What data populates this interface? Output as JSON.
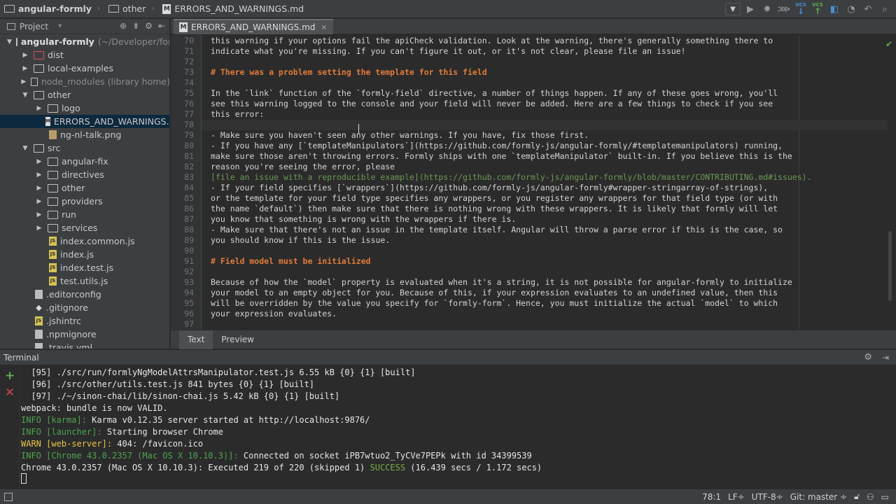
{
  "navbar": {
    "crumbs": [
      "angular-formly",
      "other",
      "ERRORS_AND_WARNINGS.md"
    ]
  },
  "project": {
    "title": "Project",
    "tree": [
      {
        "label": "angular-formly",
        "suffix": "(~/Developer/form",
        "depth": 0,
        "type": "folder",
        "open": true,
        "bold": true
      },
      {
        "label": "dist",
        "depth": 1,
        "type": "folder-red",
        "open": false
      },
      {
        "label": "local-examples",
        "depth": 1,
        "type": "folder",
        "open": false
      },
      {
        "label": "node_modules (library home)",
        "depth": 1,
        "type": "folder",
        "open": false,
        "muted": true
      },
      {
        "label": "other",
        "depth": 1,
        "type": "folder",
        "open": true
      },
      {
        "label": "logo",
        "depth": 2,
        "type": "folder",
        "open": false
      },
      {
        "label": "ERRORS_AND_WARNINGS.md",
        "depth": 2,
        "type": "md",
        "selected": true
      },
      {
        "label": "ng-nl-talk.png",
        "depth": 2,
        "type": "png"
      },
      {
        "label": "src",
        "depth": 1,
        "type": "folder",
        "open": true
      },
      {
        "label": "angular-fix",
        "depth": 2,
        "type": "folder",
        "open": false
      },
      {
        "label": "directives",
        "depth": 2,
        "type": "folder",
        "open": false
      },
      {
        "label": "other",
        "depth": 2,
        "type": "folder",
        "open": false
      },
      {
        "label": "providers",
        "depth": 2,
        "type": "folder",
        "open": false
      },
      {
        "label": "run",
        "depth": 2,
        "type": "folder",
        "open": false
      },
      {
        "label": "services",
        "depth": 2,
        "type": "folder",
        "open": false
      },
      {
        "label": "index.common.js",
        "depth": 2,
        "type": "js"
      },
      {
        "label": "index.js",
        "depth": 2,
        "type": "js"
      },
      {
        "label": "index.test.js",
        "depth": 2,
        "type": "js"
      },
      {
        "label": "test.utils.js",
        "depth": 2,
        "type": "js"
      },
      {
        "label": ".editorconfig",
        "depth": 1,
        "type": "file"
      },
      {
        "label": ".gitignore",
        "depth": 1,
        "type": "git"
      },
      {
        "label": ".jshintrc",
        "depth": 1,
        "type": "js"
      },
      {
        "label": ".npmignore",
        "depth": 1,
        "type": "file"
      },
      {
        "label": ".travis.yml",
        "depth": 1,
        "type": "file"
      }
    ]
  },
  "editor": {
    "tab_label": "ERRORS_AND_WARNINGS.md",
    "lines": [
      {
        "n": "70",
        "text": "this warning if your options fail the apiCheck validation. Look at the warning, there's generally something there to",
        "kind": "text"
      },
      {
        "n": "71",
        "text": "indicate what you're missing. If you can't figure it out, or it's not clear, please file an issue!",
        "kind": "text"
      },
      {
        "n": "72",
        "text": "",
        "kind": "text"
      },
      {
        "n": "73",
        "text": "# There was a problem setting the template for this field",
        "kind": "heading"
      },
      {
        "n": "74",
        "text": "",
        "kind": "text"
      },
      {
        "n": "75",
        "text": "In the `link` function of the `formly-field` directive, a number of things happen. If any of these goes wrong, you'll",
        "kind": "text"
      },
      {
        "n": "76",
        "text": "see this warning logged to the console and your field will never be added. Here are a few things to check if you see",
        "kind": "text"
      },
      {
        "n": "77",
        "text": "this error:",
        "kind": "text"
      },
      {
        "n": "78",
        "text": "",
        "kind": "current"
      },
      {
        "n": "79",
        "text": "- Make sure you haven't seen any other warnings. If you have, fix those first.",
        "kind": "text"
      },
      {
        "n": "80",
        "text": "- If you have any [`templateManipulators`](https://github.com/formly-js/angular-formly/#templatemanipulators) running,",
        "kind": "text"
      },
      {
        "n": "81",
        "text": "make sure those aren't throwing errors. Formly ships with one `templateManipulator` built-in. If you believe this is the",
        "kind": "text"
      },
      {
        "n": "82",
        "text": "reason you're seeing the error, please",
        "kind": "text"
      },
      {
        "n": "83",
        "text": "[file an issue with a reproducible example](https://github.com/formly-js/angular-formly/blob/master/CONTRIBUTING.md#issues).",
        "kind": "link"
      },
      {
        "n": "84",
        "text": "- If your field specifies [`wrappers`](https://github.com/formly-js/angular-formly#wrapper-stringarray-of-strings),",
        "kind": "text"
      },
      {
        "n": "85",
        "text": "or the template for your field type specifies any wrappers, or you register any wrappers for that field type (or with",
        "kind": "text"
      },
      {
        "n": "86",
        "text": "the name `default`) then make sure that there is nothing wrong with these wrappers. It is likely that formly will let",
        "kind": "text"
      },
      {
        "n": "87",
        "text": "you know that something is wrong with the wrappers if there is.",
        "kind": "text"
      },
      {
        "n": "88",
        "text": "- Make sure that there's not an issue in the template itself. Angular will throw a parse error if this is the case, so",
        "kind": "text"
      },
      {
        "n": "89",
        "text": "you should know if this is the issue.",
        "kind": "text"
      },
      {
        "n": "90",
        "text": "",
        "kind": "text"
      },
      {
        "n": "91",
        "text": "# Field model must be initialized",
        "kind": "heading"
      },
      {
        "n": "92",
        "text": "",
        "kind": "text"
      },
      {
        "n": "93",
        "text": "Because of how the `model` property is evaluated when it's a string, it is not possible for angular-formly to initialize",
        "kind": "text"
      },
      {
        "n": "94",
        "text": "your model to an empty object for you. Because of this, if your expression evaluates to an undefined value, then this",
        "kind": "text"
      },
      {
        "n": "95",
        "text": "will be overridden by the value you specify for `formly-form`. Hence, you must initialize the actual `model` to which",
        "kind": "text"
      },
      {
        "n": "96",
        "text": "your expression evaluates.",
        "kind": "text"
      },
      {
        "n": "97",
        "text": "",
        "kind": "text"
      }
    ],
    "view_tabs": [
      "Text",
      "Preview"
    ]
  },
  "terminal": {
    "title": "Terminal",
    "lines": [
      [
        {
          "t": "  [95] ./src/run/formlyNgModelAttrsManipulator.test.js 6.55 kB {0} {1} [built]",
          "c": ""
        }
      ],
      [
        {
          "t": "  [96] ./src/other/utils.test.js 841 bytes {0} {1} [built]",
          "c": ""
        }
      ],
      [
        {
          "t": "  [97] ./~/sinon-chai/lib/sinon-chai.js 5.42 kB {0} {1} [built]",
          "c": ""
        }
      ],
      [
        {
          "t": "webpack: bundle is now VALID.",
          "c": ""
        }
      ],
      [
        {
          "t": "INFO [karma]: ",
          "c": "tg"
        },
        {
          "t": "Karma v0.12.35 server started at http://localhost:9876/",
          "c": ""
        }
      ],
      [
        {
          "t": "INFO [launcher]: ",
          "c": "tg"
        },
        {
          "t": "Starting browser Chrome",
          "c": ""
        }
      ],
      [
        {
          "t": "WARN [web-server]: ",
          "c": "ty"
        },
        {
          "t": "404: /favicon.ico",
          "c": ""
        }
      ],
      [
        {
          "t": "INFO [Chrome 43.0.2357 (Mac OS X 10.10.3)]: ",
          "c": "tg"
        },
        {
          "t": "Connected on socket iPB7wtuo2_TyCVe7PEPk with id 34399539",
          "c": ""
        }
      ],
      [
        {
          "t": "Chrome 43.0.2357 (Mac OS X 10.10.3): Executed 219 of 220 (skipped 1) ",
          "c": ""
        },
        {
          "t": "SUCCESS",
          "c": "tc"
        },
        {
          "t": " (16.439 secs / 1.172 secs)",
          "c": ""
        }
      ]
    ]
  },
  "statusbar": {
    "position": "78:1",
    "line_sep": "LF÷",
    "encoding": "UTF-8÷",
    "vcs": "Git: master ÷"
  }
}
